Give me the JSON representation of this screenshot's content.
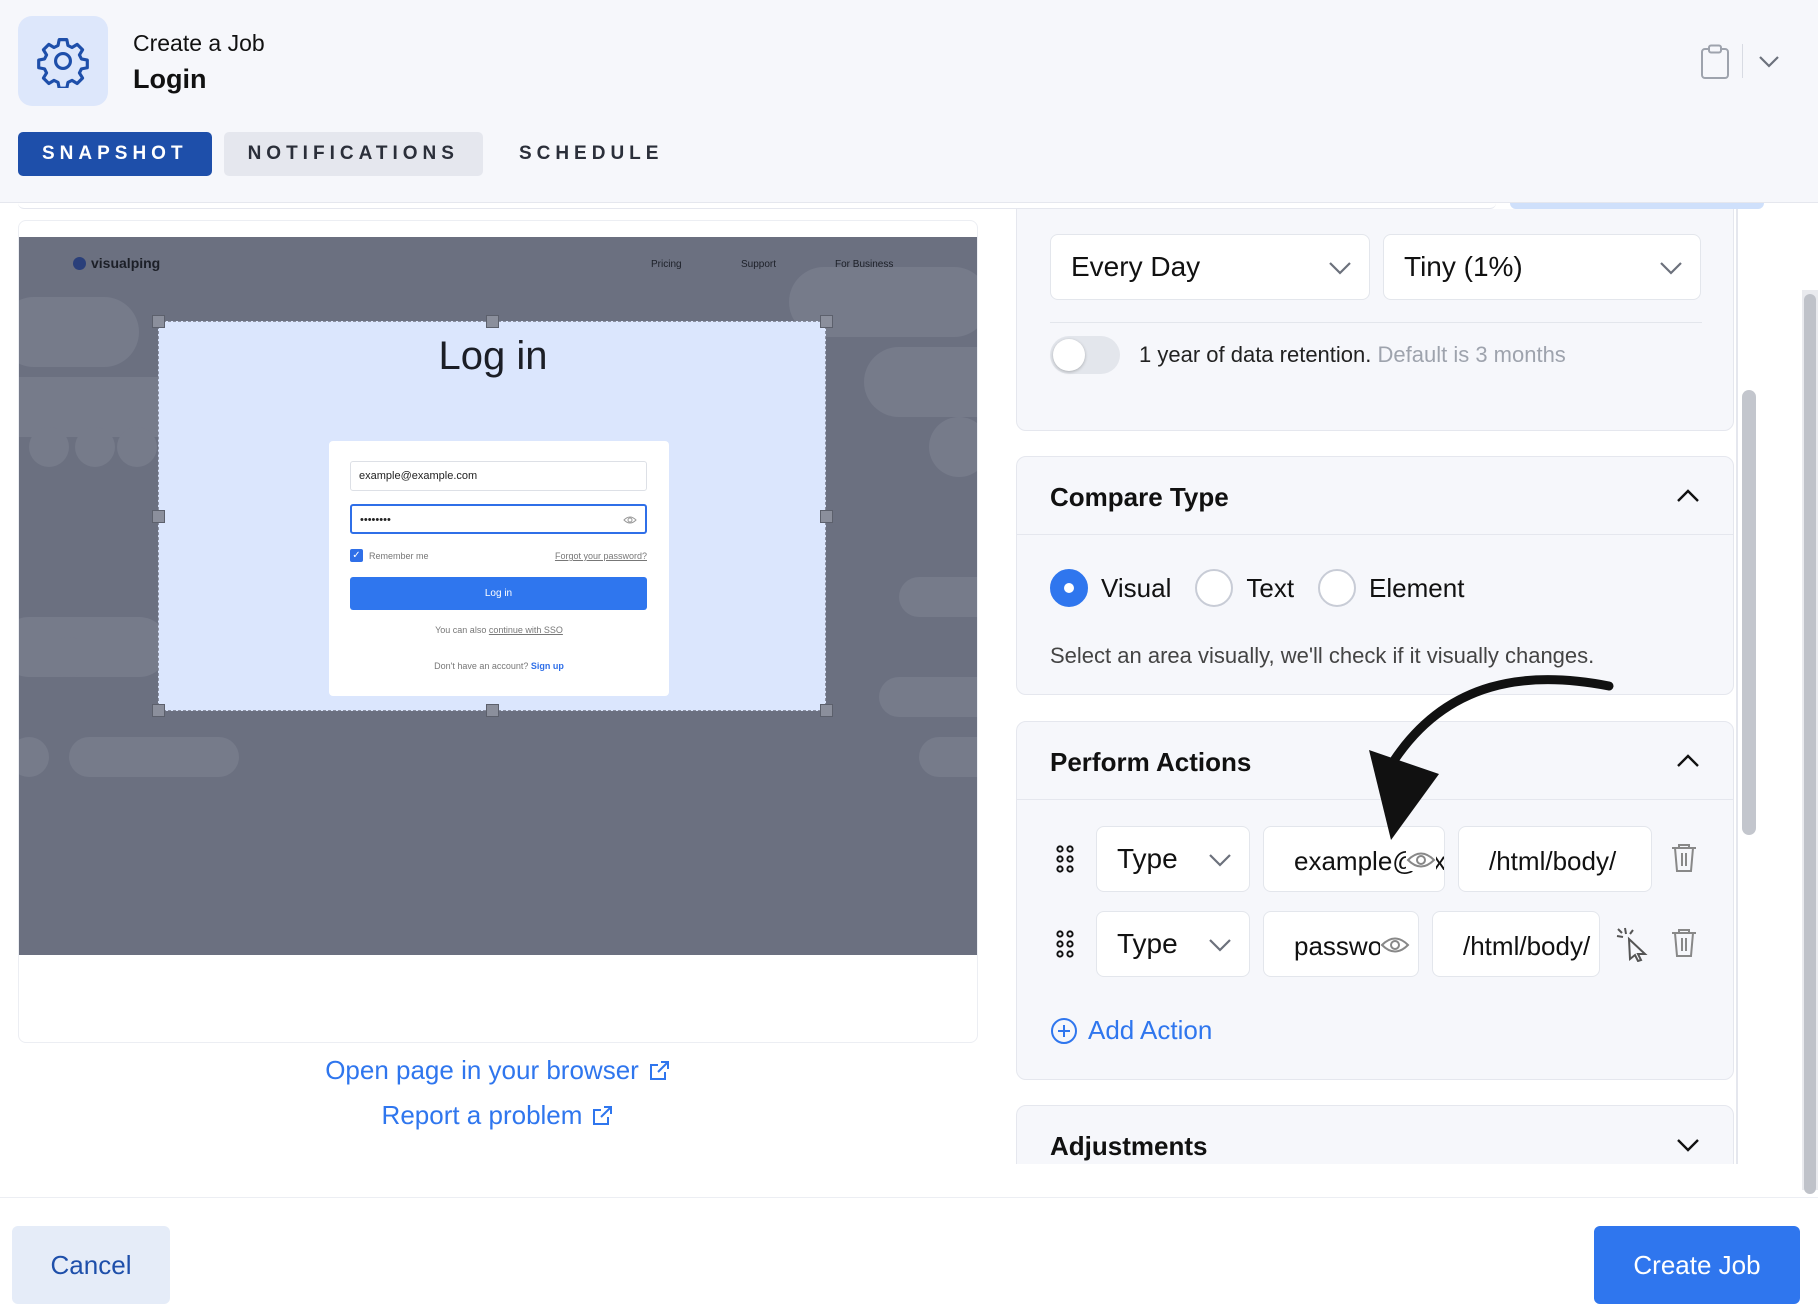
{
  "header": {
    "subtitle": "Create a Job",
    "title": "Login"
  },
  "tabs": [
    {
      "label": "SNAPSHOT",
      "active": true
    },
    {
      "label": "NOTIFICATIONS",
      "active": false
    },
    {
      "label": "SCHEDULE",
      "active": false
    }
  ],
  "preview": {
    "site_logo": "visualping",
    "nav": [
      "Pricing",
      "Support",
      "For Business"
    ],
    "login_title": "Log in",
    "email_value": "example@example.com",
    "password_value": "••••••••",
    "remember_label": "Remember me",
    "forgot_label": "Forgot your password?",
    "login_button": "Log in",
    "sso_text": "You can also",
    "sso_link": "continue with SSO",
    "signup_text": "Don't have an account?",
    "signup_link": "Sign up",
    "open_link": "Open page in your browser",
    "report_link": "Report a problem"
  },
  "frequency": {
    "interval": "Every Day",
    "threshold": "Tiny (1%)",
    "retention_label": "1 year of data retention.",
    "retention_default": "Default is 3 months",
    "retention_enabled": false
  },
  "compare": {
    "title": "Compare Type",
    "options": [
      "Visual",
      "Text",
      "Element"
    ],
    "selected": "Visual",
    "hint": "Select an area visually, we'll check if it visually changes."
  },
  "actions": {
    "title": "Perform Actions",
    "rows": [
      {
        "type": "Type",
        "value": "example@example.com",
        "xpath": "/html/body/"
      },
      {
        "type": "Type",
        "value": "password",
        "xpath": "/html/body/"
      }
    ],
    "add_label": "Add Action"
  },
  "adjustments": {
    "title": "Adjustments"
  },
  "footer": {
    "cancel": "Cancel",
    "create": "Create Job"
  },
  "colors": {
    "primary": "#2f76ee",
    "tab_active": "#1e4faa",
    "selection": "#dbe6fd"
  }
}
